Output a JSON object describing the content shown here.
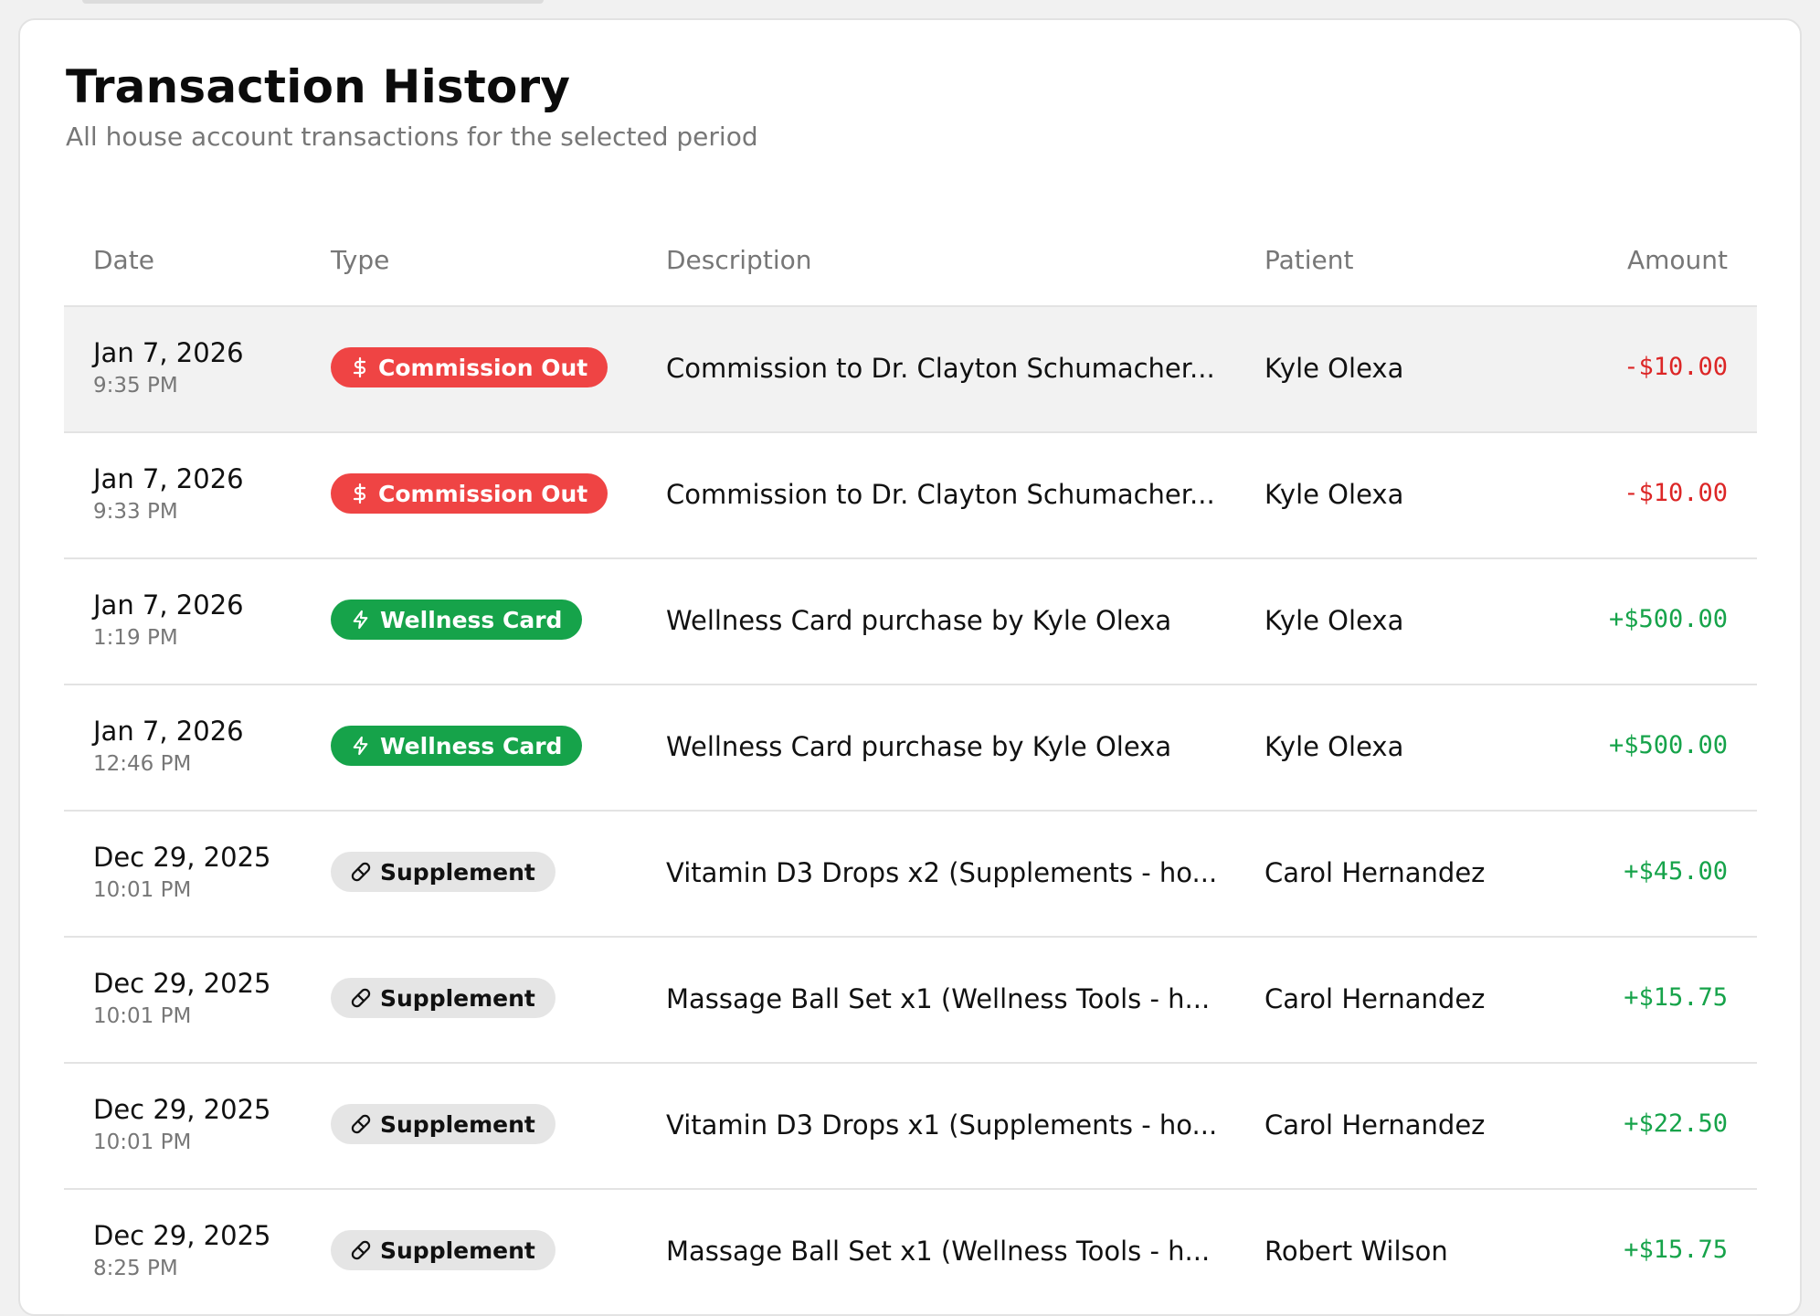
{
  "header": {
    "title": "Transaction History",
    "subtitle": "All house account transactions for the selected period"
  },
  "table": {
    "columns": {
      "date": "Date",
      "type": "Type",
      "description": "Description",
      "patient": "Patient",
      "amount": "Amount"
    },
    "rows": [
      {
        "date": "Jan 7, 2026",
        "time": "9:35 PM",
        "type": "Commission Out",
        "type_icon": "dollar-icon",
        "type_color": "#ef4444",
        "description": "Commission to Dr. Clayton Schumacher...",
        "patient": "Kyle Olexa",
        "amount": "-$10.00",
        "amount_color": "#dc2626"
      },
      {
        "date": "Jan 7, 2026",
        "time": "9:33 PM",
        "type": "Commission Out",
        "type_icon": "dollar-icon",
        "type_color": "#ef4444",
        "description": "Commission to Dr. Clayton Schumacher...",
        "patient": "Kyle Olexa",
        "amount": "-$10.00",
        "amount_color": "#dc2626"
      },
      {
        "date": "Jan 7, 2026",
        "time": "1:19 PM",
        "type": "Wellness Card",
        "type_icon": "lightning-icon",
        "type_color": "#16a34a",
        "description": "Wellness Card purchase by Kyle Olexa",
        "patient": "Kyle Olexa",
        "amount": "+$500.00",
        "amount_color": "#16a34a"
      },
      {
        "date": "Jan 7, 2026",
        "time": "12:46 PM",
        "type": "Wellness Card",
        "type_icon": "lightning-icon",
        "type_color": "#16a34a",
        "description": "Wellness Card purchase by Kyle Olexa",
        "patient": "Kyle Olexa",
        "amount": "+$500.00",
        "amount_color": "#16a34a"
      },
      {
        "date": "Dec 29, 2025",
        "time": "10:01 PM",
        "type": "Supplement",
        "type_icon": "pill-icon",
        "type_color": "#e5e5e5",
        "description": "Vitamin D3 Drops x2 (Supplements - ho...",
        "patient": "Carol Hernandez",
        "amount": "+$45.00",
        "amount_color": "#16a34a"
      },
      {
        "date": "Dec 29, 2025",
        "time": "10:01 PM",
        "type": "Supplement",
        "type_icon": "pill-icon",
        "type_color": "#e5e5e5",
        "description": "Massage Ball Set x1 (Wellness Tools - h...",
        "patient": "Carol Hernandez",
        "amount": "+$15.75",
        "amount_color": "#16a34a"
      },
      {
        "date": "Dec 29, 2025",
        "time": "10:01 PM",
        "type": "Supplement",
        "type_icon": "pill-icon",
        "type_color": "#e5e5e5",
        "description": "Vitamin D3 Drops x1 (Supplements - ho...",
        "patient": "Carol Hernandez",
        "amount": "+$22.50",
        "amount_color": "#16a34a"
      },
      {
        "date": "Dec 29, 2025",
        "time": "8:25 PM",
        "type": "Supplement",
        "type_icon": "pill-icon",
        "type_color": "#e5e5e5",
        "description": "Massage Ball Set x1 (Wellness Tools - h...",
        "patient": "Robert Wilson",
        "amount": "+$15.75",
        "amount_color": "#16a34a"
      }
    ]
  }
}
